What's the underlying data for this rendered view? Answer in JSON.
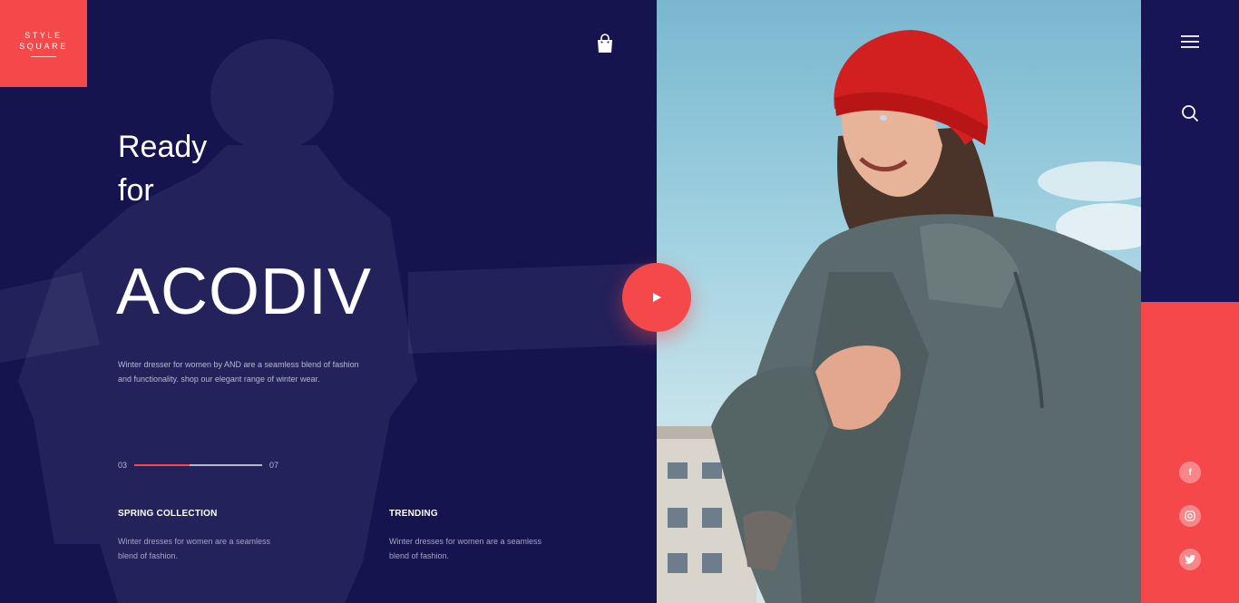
{
  "brand": {
    "line1": "STYLE",
    "line2": "SQUARE",
    "color": "#f5484a"
  },
  "header": {
    "cart_icon": "shopping-bag-icon"
  },
  "hero": {
    "headline_line1": "Ready",
    "headline_line2": "for",
    "headline_big": "ACODIV",
    "description": "Winter dresser for women by AND are a seamless blend of fashion and functionality. shop our elegant range of winter wear."
  },
  "slider": {
    "current": "03",
    "total": "07",
    "progress_fraction": 0.43
  },
  "columns": [
    {
      "title": "SPRING COLLECTION",
      "text": "Winter dresses for women are a seamless blend of fashion."
    },
    {
      "title": "TRENDING",
      "text": "Winter dresses for women are a seamless blend of fashion."
    }
  ],
  "play_button": {
    "icon": "play-icon"
  },
  "rail": {
    "menu_icon": "hamburger-menu-icon",
    "search_icon": "search-icon",
    "social": [
      "facebook-icon",
      "instagram-icon",
      "twitter-icon"
    ]
  },
  "colors": {
    "navy": "#16144f",
    "accent": "#f5484a"
  }
}
